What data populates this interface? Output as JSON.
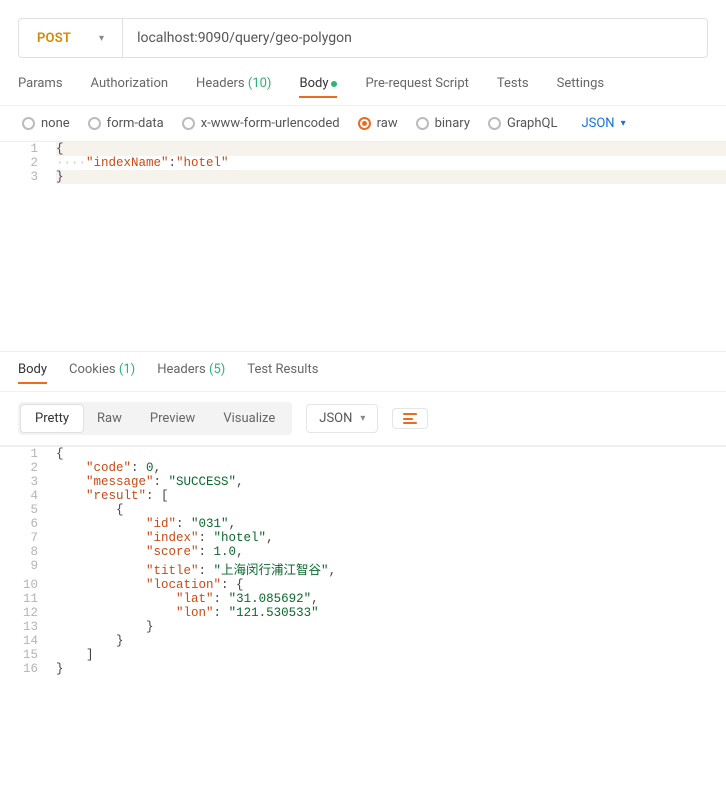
{
  "request": {
    "method": "POST",
    "url": "localhost:9090/query/geo-polygon",
    "tabs": {
      "params": "Params",
      "auth": "Authorization",
      "headers": "Headers",
      "headers_count": "(10)",
      "body": "Body",
      "prerequest": "Pre-request Script",
      "tests": "Tests",
      "settings": "Settings"
    },
    "body_types": {
      "none": "none",
      "form_data": "form-data",
      "urlencoded": "x-www-form-urlencoded",
      "raw": "raw",
      "binary": "binary",
      "graphql": "GraphQL",
      "raw_type": "JSON"
    },
    "body_lines": [
      {
        "n": "1",
        "parts": [
          {
            "t": "{",
            "c": "punct"
          }
        ]
      },
      {
        "n": "2",
        "parts": [
          {
            "t": "····",
            "c": "dots"
          },
          {
            "t": "\"indexName\"",
            "c": "str"
          },
          {
            "t": ":",
            "c": "punct"
          },
          {
            "t": "\"hotel\"",
            "c": "str"
          }
        ]
      },
      {
        "n": "3",
        "parts": [
          {
            "t": "}",
            "c": "punct"
          }
        ]
      }
    ]
  },
  "response": {
    "tabs": {
      "body": "Body",
      "cookies": "Cookies",
      "cookies_count": "(1)",
      "headers": "Headers",
      "headers_count": "(5)",
      "test_results": "Test Results"
    },
    "views": {
      "pretty": "Pretty",
      "raw": "Raw",
      "preview": "Preview",
      "visualize": "Visualize",
      "content_type": "JSON"
    },
    "json_lines": [
      {
        "n": "1",
        "indent": 0,
        "parts": [
          {
            "t": "{",
            "c": "punct"
          }
        ]
      },
      {
        "n": "2",
        "indent": 1,
        "parts": [
          {
            "t": "\"code\"",
            "c": "str"
          },
          {
            "t": ": ",
            "c": ""
          },
          {
            "t": "0",
            "c": "num"
          },
          {
            "t": ",",
            "c": ""
          }
        ]
      },
      {
        "n": "3",
        "indent": 1,
        "parts": [
          {
            "t": "\"message\"",
            "c": "str"
          },
          {
            "t": ": ",
            "c": ""
          },
          {
            "t": "\"SUCCESS\"",
            "c": "num"
          },
          {
            "t": ",",
            "c": ""
          }
        ]
      },
      {
        "n": "4",
        "indent": 1,
        "parts": [
          {
            "t": "\"result\"",
            "c": "str"
          },
          {
            "t": ": [",
            "c": ""
          }
        ]
      },
      {
        "n": "5",
        "indent": 2,
        "parts": [
          {
            "t": "{",
            "c": "punct"
          }
        ]
      },
      {
        "n": "6",
        "indent": 3,
        "parts": [
          {
            "t": "\"id\"",
            "c": "str"
          },
          {
            "t": ": ",
            "c": ""
          },
          {
            "t": "\"031\"",
            "c": "num"
          },
          {
            "t": ",",
            "c": ""
          }
        ]
      },
      {
        "n": "7",
        "indent": 3,
        "parts": [
          {
            "t": "\"index\"",
            "c": "str"
          },
          {
            "t": ": ",
            "c": ""
          },
          {
            "t": "\"hotel\"",
            "c": "num"
          },
          {
            "t": ",",
            "c": ""
          }
        ]
      },
      {
        "n": "8",
        "indent": 3,
        "parts": [
          {
            "t": "\"score\"",
            "c": "str"
          },
          {
            "t": ": ",
            "c": ""
          },
          {
            "t": "1.0",
            "c": "num"
          },
          {
            "t": ",",
            "c": ""
          }
        ]
      },
      {
        "n": "9",
        "indent": 3,
        "parts": [
          {
            "t": "\"title\"",
            "c": "str"
          },
          {
            "t": ": ",
            "c": ""
          },
          {
            "t": "\"上海闵行浦江智谷\"",
            "c": "num"
          },
          {
            "t": ",",
            "c": ""
          }
        ]
      },
      {
        "n": "10",
        "indent": 3,
        "parts": [
          {
            "t": "\"location\"",
            "c": "str"
          },
          {
            "t": ": {",
            "c": ""
          }
        ]
      },
      {
        "n": "11",
        "indent": 4,
        "parts": [
          {
            "t": "\"lat\"",
            "c": "str"
          },
          {
            "t": ": ",
            "c": ""
          },
          {
            "t": "\"31.085692\"",
            "c": "num"
          },
          {
            "t": ",",
            "c": ""
          }
        ]
      },
      {
        "n": "12",
        "indent": 4,
        "parts": [
          {
            "t": "\"lon\"",
            "c": "str"
          },
          {
            "t": ": ",
            "c": ""
          },
          {
            "t": "\"121.530533\"",
            "c": "num"
          }
        ]
      },
      {
        "n": "13",
        "indent": 3,
        "parts": [
          {
            "t": "}",
            "c": "punct"
          }
        ]
      },
      {
        "n": "14",
        "indent": 2,
        "parts": [
          {
            "t": "}",
            "c": "punct"
          }
        ]
      },
      {
        "n": "15",
        "indent": 1,
        "parts": [
          {
            "t": "]",
            "c": ""
          }
        ]
      },
      {
        "n": "16",
        "indent": 0,
        "parts": [
          {
            "t": "}",
            "c": "punct"
          }
        ]
      }
    ]
  }
}
